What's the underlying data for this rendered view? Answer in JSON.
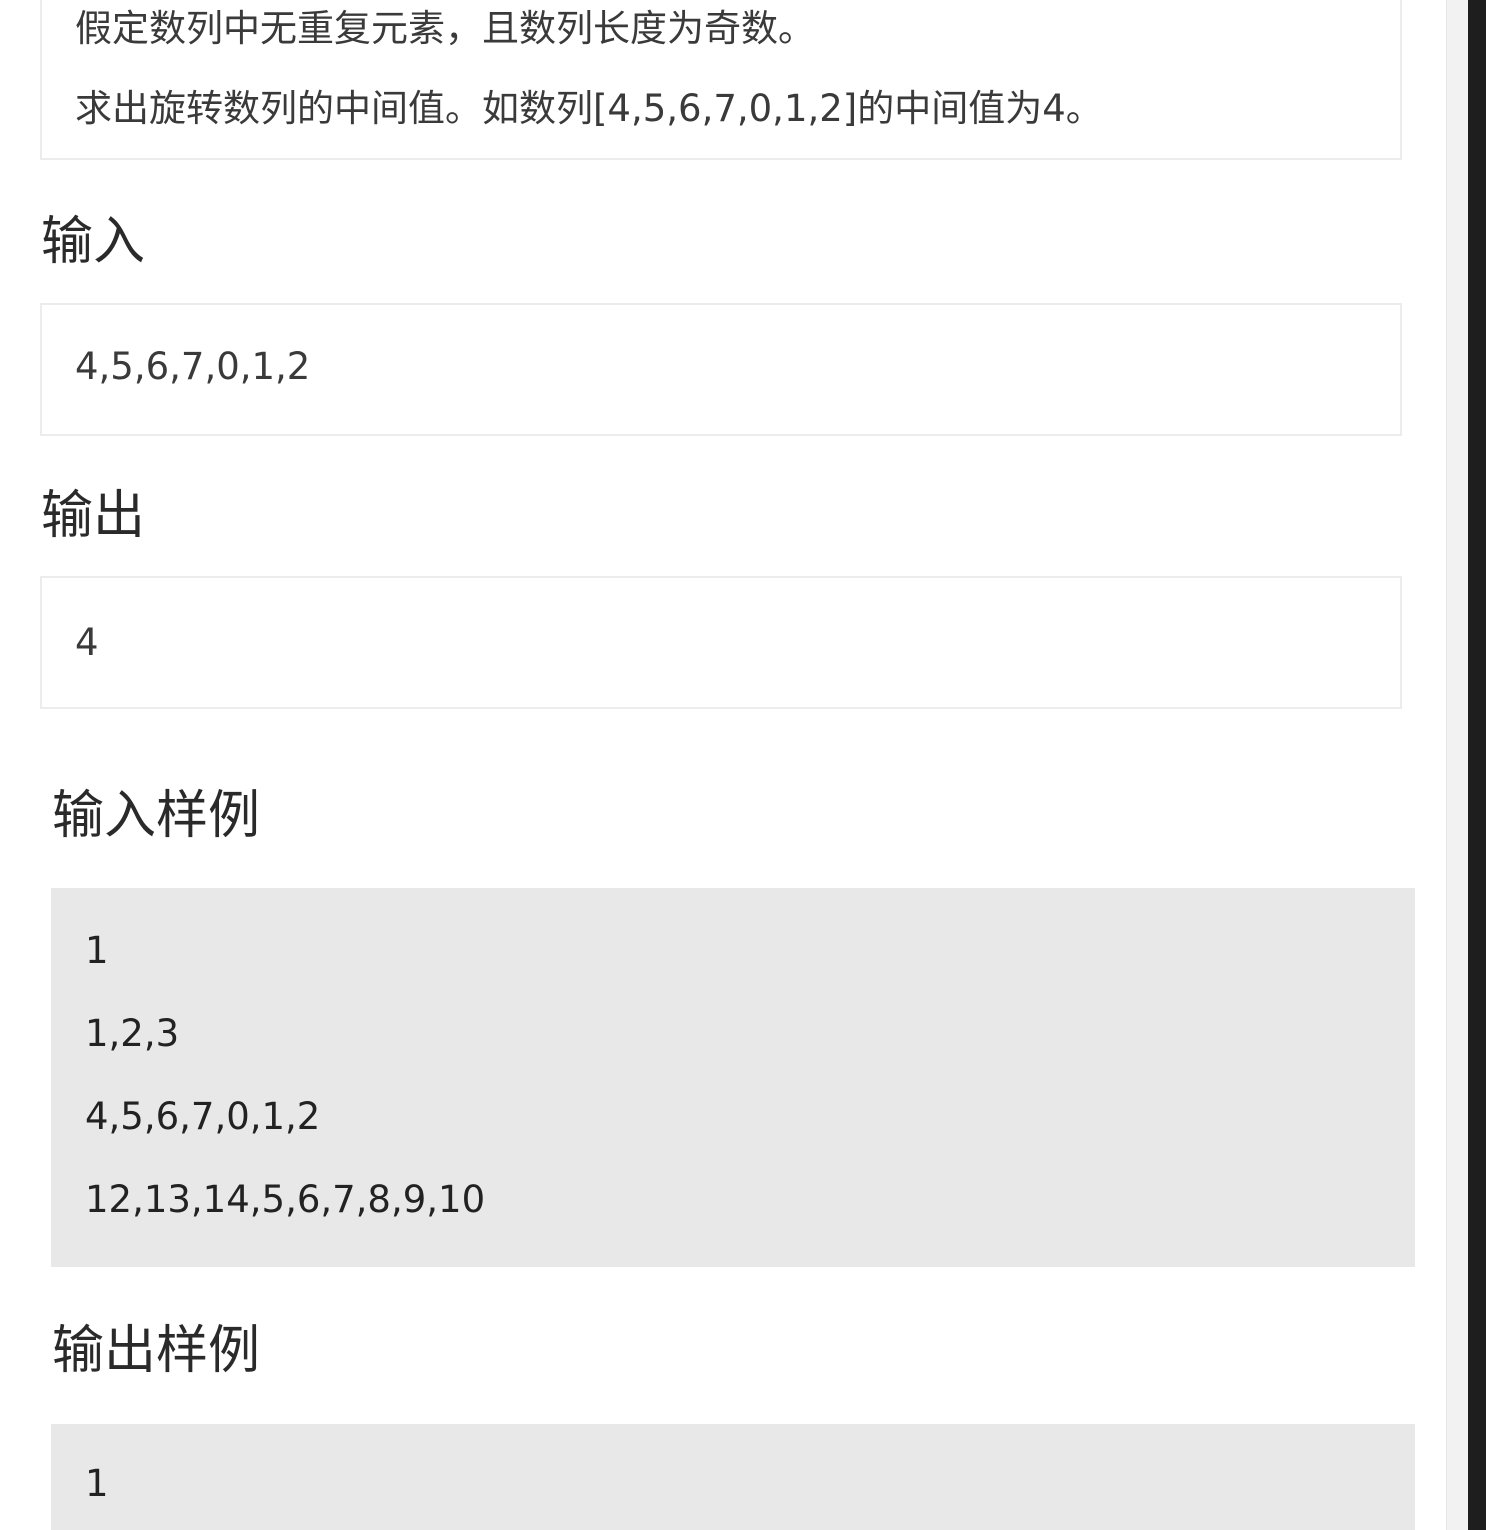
{
  "description": {
    "line1": "假定数列中无重复元素，且数列长度为奇数。",
    "line2": "求出旋转数列的中间值。如数列[4,5,6,7,0,1,2]的中间值为4。"
  },
  "input": {
    "heading": "输入",
    "value": "4,5,6,7,0,1,2"
  },
  "output": {
    "heading": "输出",
    "value": "4"
  },
  "sample_input": {
    "heading": "输入样例",
    "lines": [
      "1",
      "1,2,3",
      "4,5,6,7,0,1,2",
      "12,13,14,5,6,7,8,9,10"
    ]
  },
  "sample_output": {
    "heading": "输出样例",
    "lines": [
      "1"
    ]
  }
}
